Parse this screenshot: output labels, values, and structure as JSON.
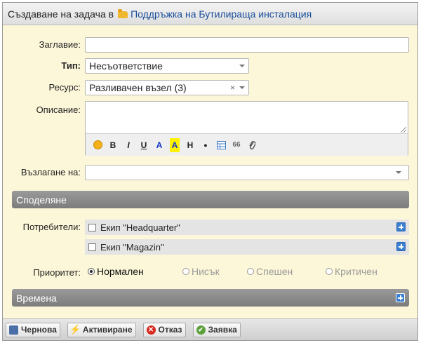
{
  "header": {
    "title_prefix": "Създаване на задача в",
    "project_name": "Поддръжка на Бутилираща инсталация"
  },
  "form": {
    "title_label": "Заглавие:",
    "title_value": "",
    "type_label": "Тип:",
    "type_value": "Несъответствие",
    "resource_label": "Ресурс:",
    "resource_value": "Разливачен възел (3)",
    "resource_clear": "×",
    "description_label": "Описание:",
    "description_value": "",
    "toolbar": {
      "bold": "B",
      "italic": "I",
      "underline": "U",
      "color": "A",
      "highlight": "A",
      "heading": "H",
      "bullet": "●",
      "quote": "66"
    },
    "assign_label": "Възлагане на:",
    "assign_value": ""
  },
  "sharing": {
    "section_title": "Споделяне",
    "users_label": "Потребители:",
    "users": [
      {
        "name": "Екип \"Headquarter\"",
        "checked": false
      },
      {
        "name": "Екип \"Magazin\"",
        "checked": false
      }
    ]
  },
  "priority": {
    "label": "Приоритет:",
    "options": [
      {
        "label": "Нормален",
        "checked": true
      },
      {
        "label": "Нисък",
        "checked": false
      },
      {
        "label": "Спешен",
        "checked": false
      },
      {
        "label": "Критичен",
        "checked": false
      }
    ]
  },
  "times": {
    "section_title": "Времена"
  },
  "footer": {
    "draft": "Чернова",
    "activate": "Активиране",
    "cancel": "Отказ",
    "request": "Заявка"
  },
  "colors": {
    "form_bg": "#fdf7d9",
    "section_bar": "#8a8a8a",
    "link": "#1a4e9a",
    "accent_plus": "#3b7fd0"
  }
}
